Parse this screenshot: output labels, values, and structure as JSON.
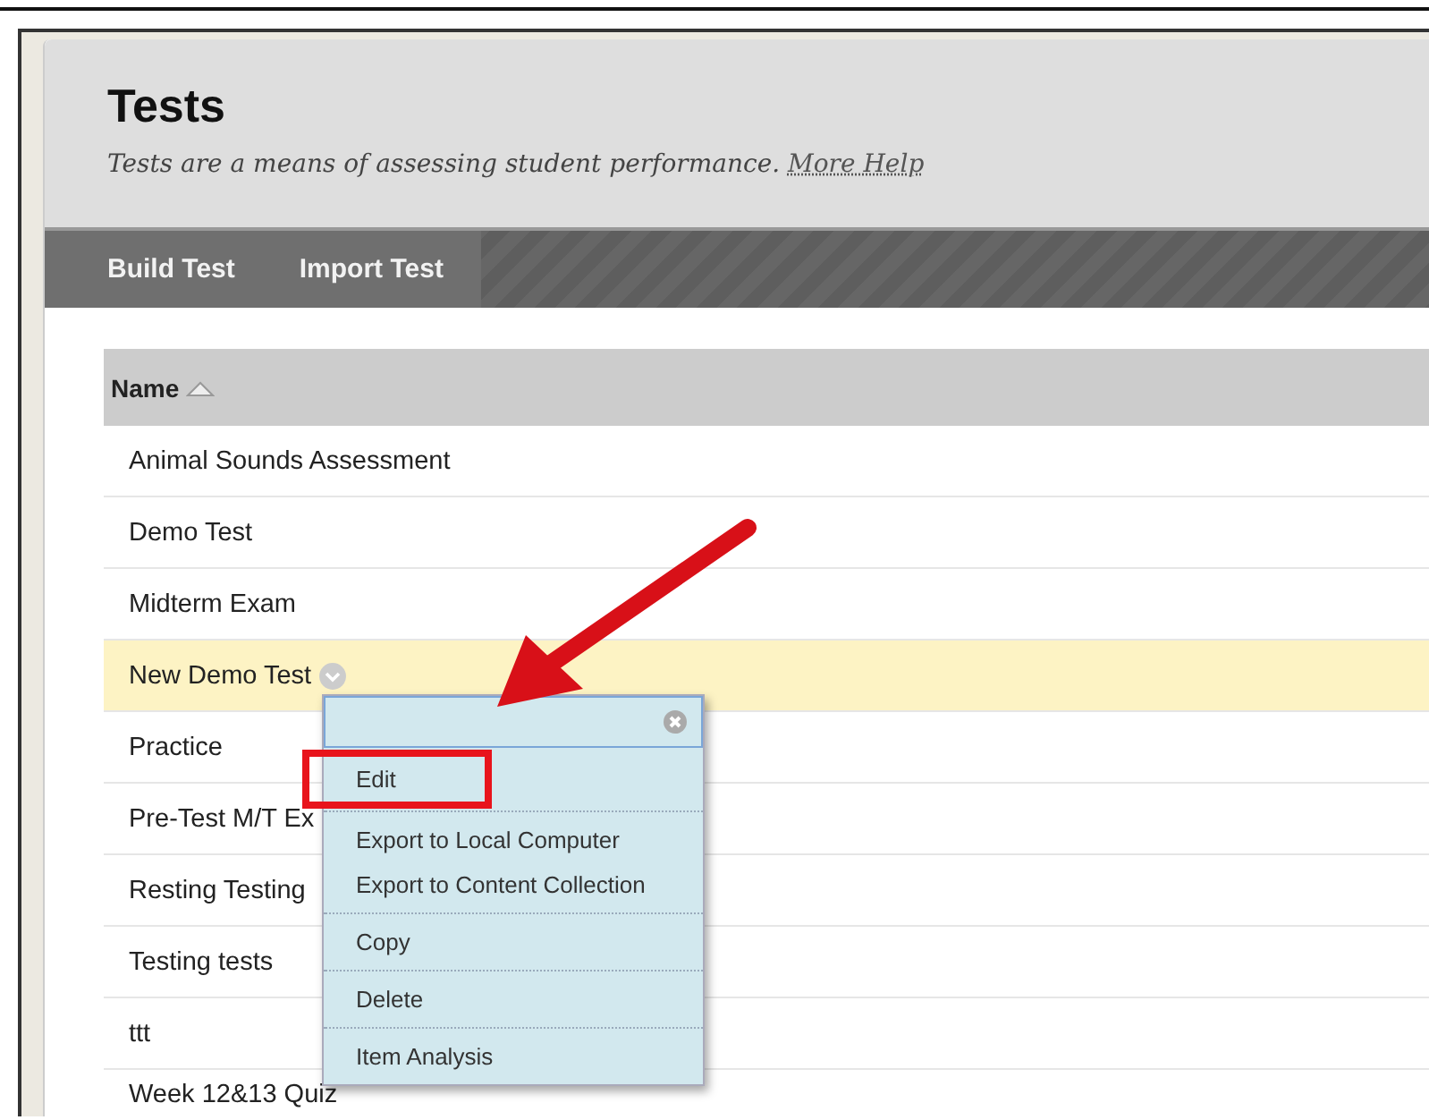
{
  "page": {
    "title": "Tests",
    "description": "Tests are a means of assessing student performance.",
    "help_link": "More Help"
  },
  "toolbar": [
    {
      "label": "Build Test"
    },
    {
      "label": "Import Test"
    }
  ],
  "table": {
    "columns": [
      {
        "label": "Name"
      }
    ],
    "rows": [
      {
        "name": "Animal Sounds Assessment",
        "selected": false
      },
      {
        "name": "Demo Test",
        "selected": false
      },
      {
        "name": "Midterm Exam",
        "selected": false
      },
      {
        "name": "New Demo Test",
        "selected": true
      },
      {
        "name": "Practice",
        "selected": false
      },
      {
        "name": "Pre-Test M/T Ex",
        "selected": false
      },
      {
        "name": "Resting Testing",
        "selected": false
      },
      {
        "name": "Testing tests",
        "selected": false
      },
      {
        "name": "ttt",
        "selected": false
      },
      {
        "name": "Week 12&13 Quiz",
        "selected": false
      }
    ]
  },
  "context_menu": {
    "groups": [
      [
        {
          "label": "Edit",
          "highlighted": true
        }
      ],
      [
        {
          "label": "Export to Local Computer",
          "highlighted": false
        },
        {
          "label": "Export to Content Collection",
          "highlighted": false
        }
      ],
      [
        {
          "label": "Copy",
          "highlighted": false
        }
      ],
      [
        {
          "label": "Delete",
          "highlighted": false
        }
      ],
      [
        {
          "label": "Item Analysis",
          "highlighted": false
        }
      ]
    ]
  }
}
